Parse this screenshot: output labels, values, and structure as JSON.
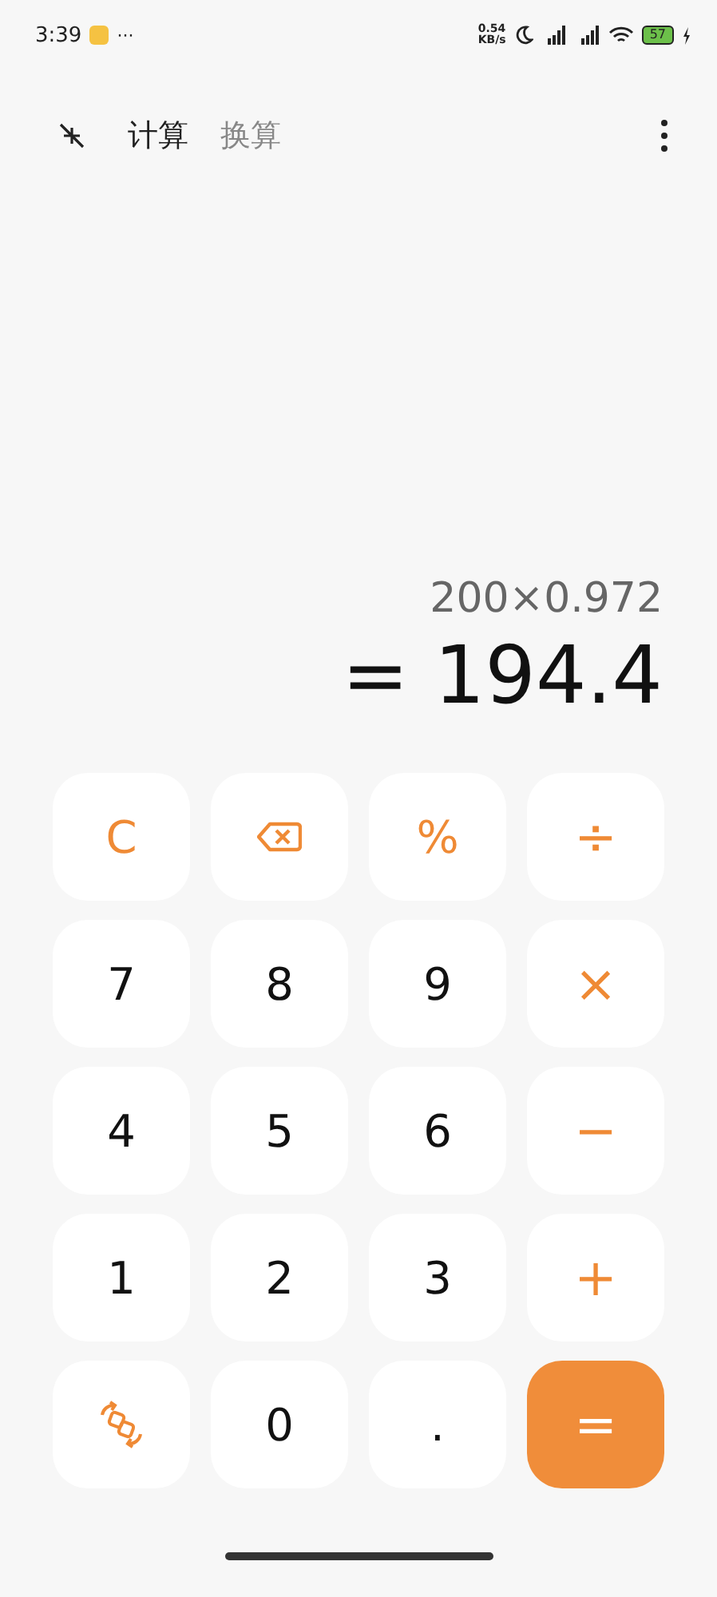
{
  "status_bar": {
    "time": "3:39",
    "more": "···",
    "speed": [
      "0.54",
      "KB/s"
    ],
    "battery": "57"
  },
  "tabs": [
    {
      "label": "计算",
      "selected": true
    },
    {
      "label": "换算",
      "selected": false
    }
  ],
  "display": {
    "expression": "200×0.972",
    "result": "= 194.4"
  },
  "keys": [
    {
      "kind": "func",
      "label": "C"
    },
    {
      "kind": "backspace"
    },
    {
      "kind": "func",
      "label": "%"
    },
    {
      "kind": "op",
      "label": "÷"
    },
    {
      "kind": "digit",
      "label": "7"
    },
    {
      "kind": "digit",
      "label": "8"
    },
    {
      "kind": "digit",
      "label": "9"
    },
    {
      "kind": "op",
      "label": "×"
    },
    {
      "kind": "digit",
      "label": "4"
    },
    {
      "kind": "digit",
      "label": "5"
    },
    {
      "kind": "digit",
      "label": "6"
    },
    {
      "kind": "op",
      "label": "−"
    },
    {
      "kind": "digit",
      "label": "1"
    },
    {
      "kind": "digit",
      "label": "2"
    },
    {
      "kind": "digit",
      "label": "3"
    },
    {
      "kind": "op",
      "label": "+"
    },
    {
      "kind": "convert"
    },
    {
      "kind": "digit",
      "label": "0"
    },
    {
      "kind": "digit",
      "label": "."
    },
    {
      "kind": "equals",
      "label": "="
    }
  ]
}
